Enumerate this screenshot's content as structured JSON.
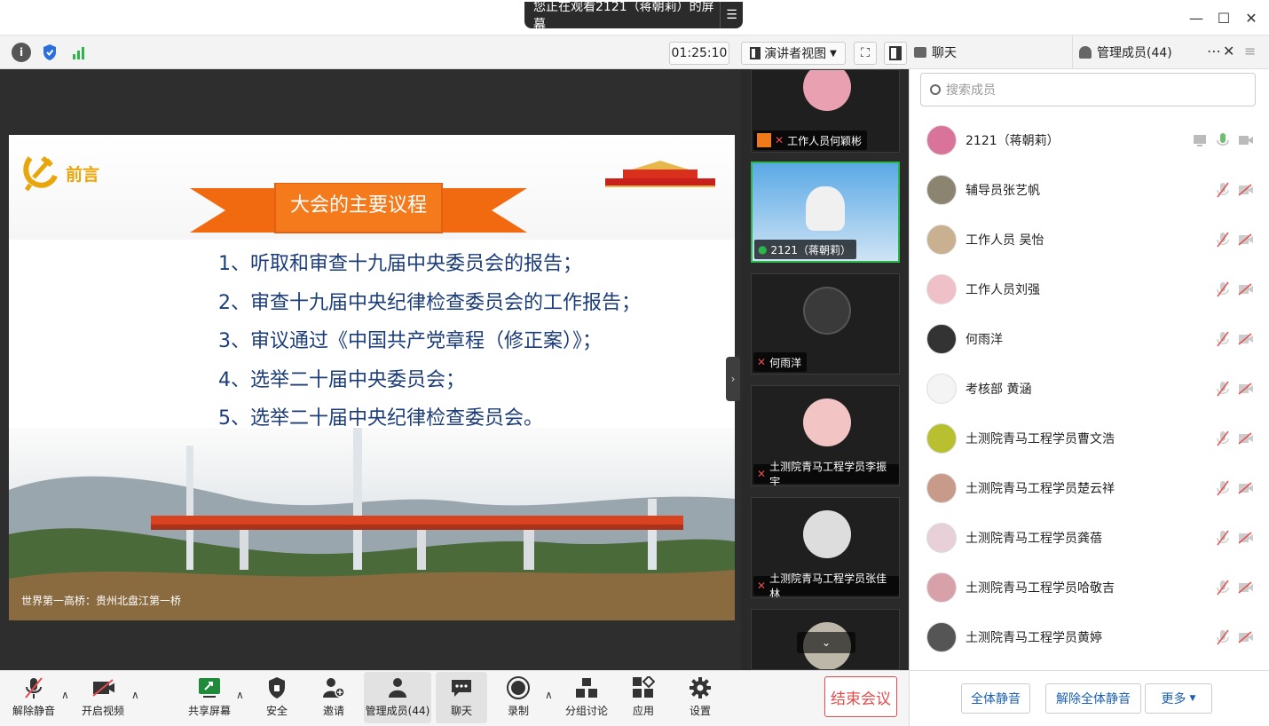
{
  "titlebar": {
    "sharing_text": "您正在观看2121（蒋朝莉）的屏幕"
  },
  "toolbar": {
    "timer": "01:25:10",
    "view_label": "演讲者视图"
  },
  "right_tabs": {
    "chat": "聊天",
    "members": "管理成员(44)"
  },
  "slide": {
    "section": "前言",
    "banner": "大会的主要议程",
    "items": [
      "1、听取和审查十九届中央委员会的报告；",
      "2、审查十九届中央纪律检查委员会的工作报告；",
      "3、审议通过《中国共产党章程（修正案）》；",
      "4、选举二十届中央委员会；",
      "5、选举二十届中央纪律检查委员会。"
    ],
    "caption": "世界第一高桥：贵州北盘江第一桥"
  },
  "thumbnails": [
    {
      "name": "工作人员何颖彬",
      "color": "#e9a0b0"
    },
    {
      "name": "2121（蒋朝莉）",
      "color": "#cfe4f4"
    },
    {
      "name": "何雨洋",
      "color": "#3a3a3a"
    },
    {
      "name": "土测院青马工程学员李振宇",
      "color": "#f2c4c4"
    },
    {
      "name": "土测院青马工程学员张佳林",
      "color": "#dddddd"
    }
  ],
  "search": {
    "placeholder": "搜索成员"
  },
  "members": [
    {
      "name": "2121（蒋朝莉）",
      "color": "#d9739a"
    },
    {
      "name": "辅导员张艺帆",
      "color": "#8a8470"
    },
    {
      "name": "工作人员 吴怡",
      "color": "#c8b090"
    },
    {
      "name": "工作人员刘强",
      "color": "#f0c0c8"
    },
    {
      "name": "何雨洋",
      "color": "#333333"
    },
    {
      "name": "考核部 黄涵",
      "color": "#f4f4f4"
    },
    {
      "name": "土测院青马工程学员曹文浩",
      "color": "#b8c030"
    },
    {
      "name": "土测院青马工程学员楚云祥",
      "color": "#c89a8a"
    },
    {
      "name": "土测院青马工程学员龚蓓",
      "color": "#e8d0d8"
    },
    {
      "name": "土测院青马工程学员哈敬吉",
      "color": "#d8a0a8"
    },
    {
      "name": "土测院青马工程学员黄婷",
      "color": "#555555"
    }
  ],
  "bottom": {
    "mute": "解除静音",
    "video": "开启视频",
    "share": "共享屏幕",
    "security": "安全",
    "invite": "邀请",
    "members": "管理成员(44)",
    "chat": "聊天",
    "record": "录制",
    "breakout": "分组讨论",
    "apps": "应用",
    "settings": "设置",
    "end": "结束会议"
  },
  "member_actions": {
    "mute_all": "全体静音",
    "unmute_all": "解除全体静音",
    "more": "更多"
  }
}
